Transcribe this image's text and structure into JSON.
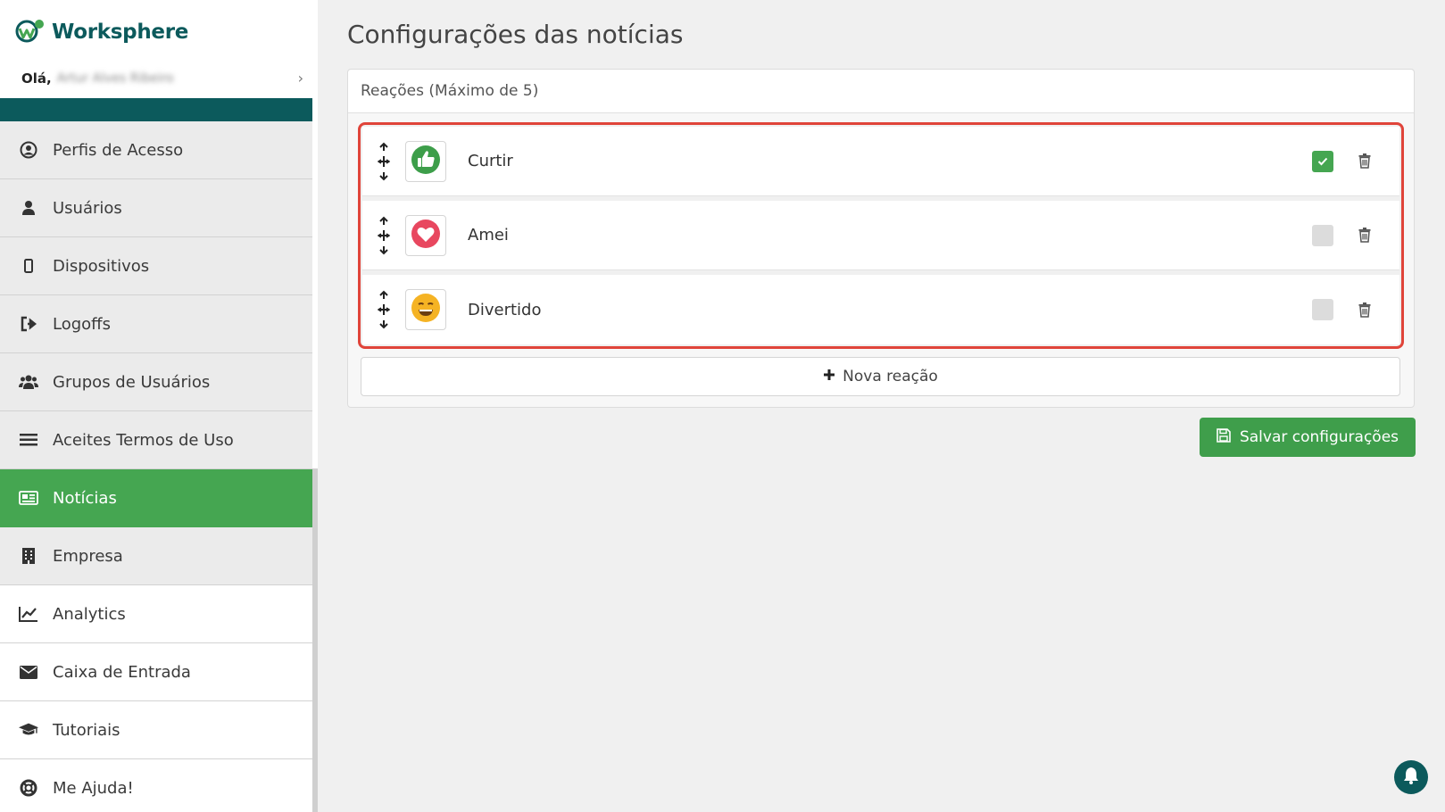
{
  "brand": {
    "name": "Worksphere"
  },
  "user": {
    "greeting": "Olá,",
    "name": "Artur Alves Ribeiro"
  },
  "colors": {
    "teal": "#0c5a5c",
    "green": "#45a651",
    "highlight": "#e0443a"
  },
  "sidebar": {
    "items": [
      {
        "label": "Perfis de Acesso",
        "icon": "user-circle-icon"
      },
      {
        "label": "Usuários",
        "icon": "user-icon"
      },
      {
        "label": "Dispositivos",
        "icon": "mobile-icon"
      },
      {
        "label": "Logoffs",
        "icon": "sign-out-icon"
      },
      {
        "label": "Grupos de Usuários",
        "icon": "users-icon"
      },
      {
        "label": "Aceites Termos de Uso",
        "icon": "list-icon"
      },
      {
        "label": "Notícias",
        "icon": "newspaper-icon",
        "active": true
      },
      {
        "label": "Empresa",
        "icon": "building-icon"
      },
      {
        "label": "Analytics",
        "icon": "chart-line-icon"
      },
      {
        "label": "Caixa de Entrada",
        "icon": "envelope-icon"
      },
      {
        "label": "Tutoriais",
        "icon": "graduation-cap-icon"
      },
      {
        "label": "Me Ajuda!",
        "icon": "life-ring-icon"
      }
    ]
  },
  "main": {
    "title": "Configurações das notícias",
    "reactions_header": "Reações (Máximo de 5)",
    "reactions": [
      {
        "name": "Curtir",
        "icon": "thumbs-up-icon",
        "enabled": true
      },
      {
        "name": "Amei",
        "icon": "heart-icon",
        "enabled": false
      },
      {
        "name": "Divertido",
        "icon": "grin-icon",
        "enabled": false
      }
    ],
    "new_reaction_label": "Nova reação",
    "save_label": "Salvar configurações"
  }
}
